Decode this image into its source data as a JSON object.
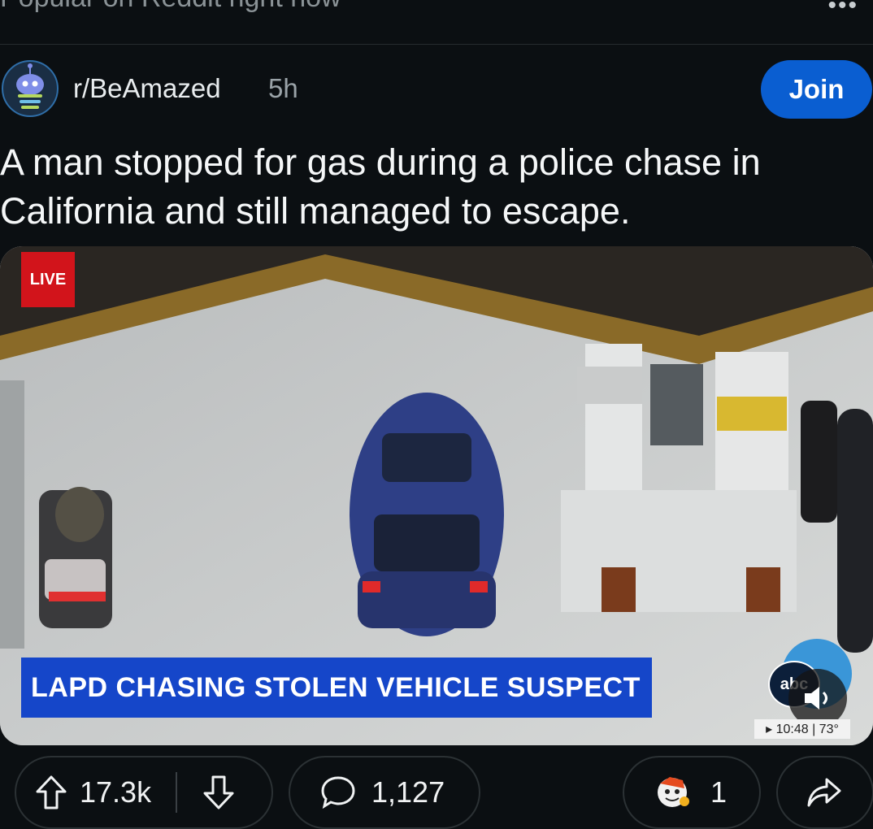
{
  "topbar": {
    "title": "Popular on Reddit right now",
    "more_icon": "•••"
  },
  "post": {
    "subreddit": "r/BeAmazed",
    "age": "5h",
    "join_label": "Join",
    "title": "A man stopped for gas during a police chase in California and still managed to escape."
  },
  "video": {
    "live_label": "LIVE",
    "banner_text": "LAPD CHASING STOLEN VEHICLE SUSPECT",
    "logo_text": "abc",
    "time_temp": "▸ 10:48 | 73°"
  },
  "actions": {
    "upvotes": "17.3k",
    "comments": "1,127",
    "awards": "1"
  },
  "colors": {
    "background": "#0b0f12",
    "join_button": "#0a5ed1",
    "live_red": "#d2141b",
    "banner_blue": "#1546c9"
  },
  "icons": [
    "more-icon",
    "subreddit-avatar",
    "upvote-icon",
    "downvote-icon",
    "comment-icon",
    "award-icon",
    "share-icon",
    "mute-icon"
  ]
}
